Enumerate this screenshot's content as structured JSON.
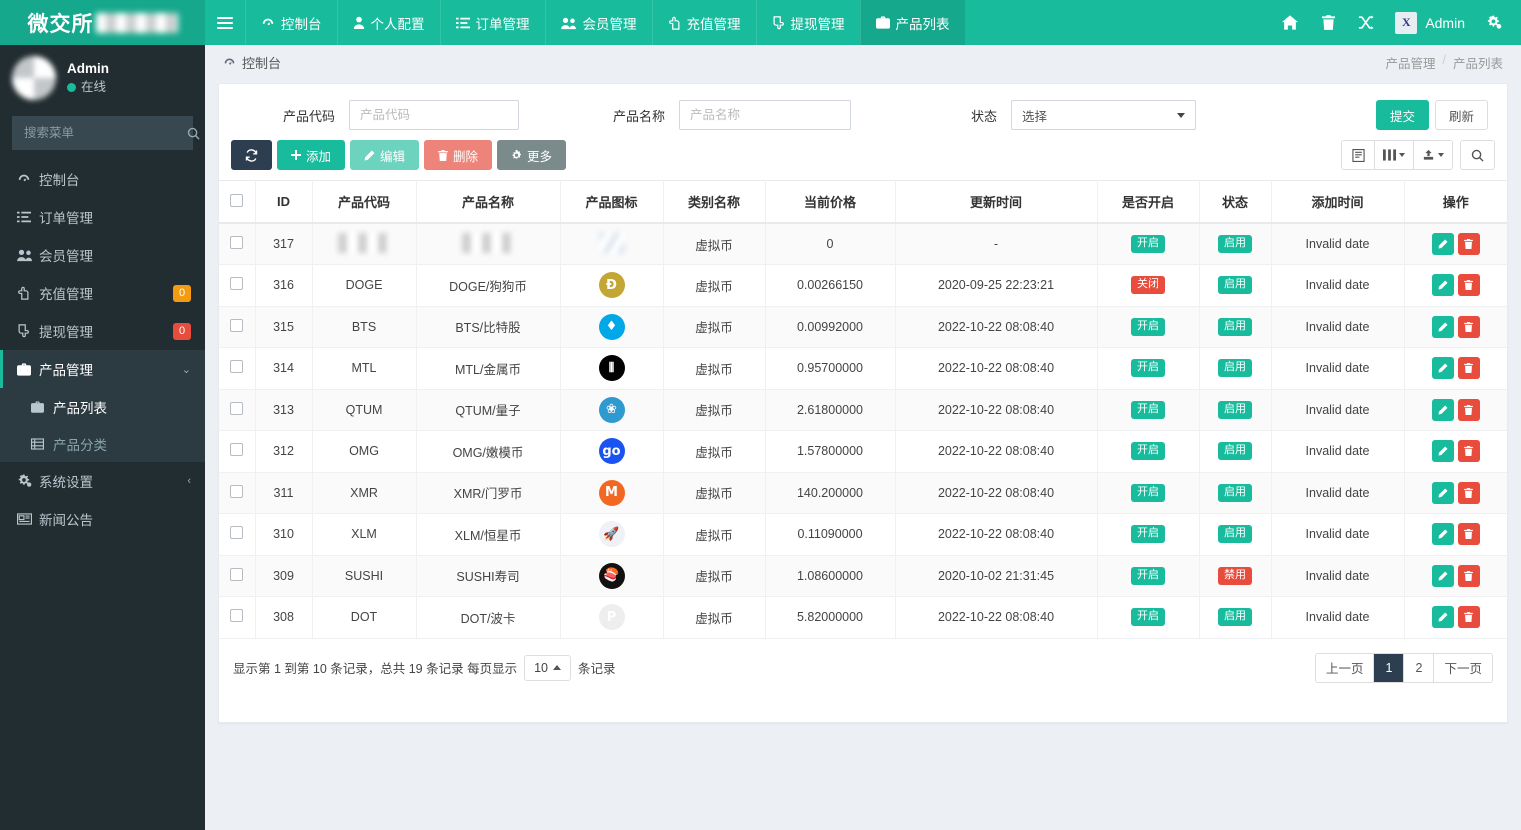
{
  "navbar": {
    "brand": "微交所",
    "brand_redacted": true,
    "toggle_label": "菜单",
    "items": [
      {
        "label": "控制台",
        "icon": "dashboard-icon",
        "active": false
      },
      {
        "label": "个人配置",
        "icon": "user-icon",
        "active": false
      },
      {
        "label": "订单管理",
        "icon": "list-icon",
        "active": false
      },
      {
        "label": "会员管理",
        "icon": "users-icon",
        "active": false
      },
      {
        "label": "充值管理",
        "icon": "hand-up-icon",
        "active": false
      },
      {
        "label": "提现管理",
        "icon": "hand-down-icon",
        "active": false
      },
      {
        "label": "产品列表",
        "icon": "briefcase-icon",
        "active": true
      }
    ],
    "right_icons": [
      "home-icon",
      "trash-icon",
      "shuffle-icon"
    ],
    "user": "Admin",
    "avatar_text": "X",
    "settings_icon": "gears-icon"
  },
  "sidebar": {
    "user_name": "Admin",
    "user_status": "在线",
    "search_placeholder": "搜索菜单",
    "search_value": "",
    "items": [
      {
        "label": "控制台",
        "icon": "dashboard-icon",
        "badge": "",
        "badge_color": "",
        "active": false,
        "caret": ""
      },
      {
        "label": "订单管理",
        "icon": "list-icon",
        "badge": "",
        "badge_color": "",
        "active": false,
        "caret": ""
      },
      {
        "label": "会员管理",
        "icon": "users-icon",
        "badge": "",
        "badge_color": "",
        "active": false,
        "caret": ""
      },
      {
        "label": "充值管理",
        "icon": "hand-up-icon",
        "badge": "0",
        "badge_color": "#f39c12",
        "active": false,
        "caret": ""
      },
      {
        "label": "提现管理",
        "icon": "hand-down-icon",
        "badge": "0",
        "badge_color": "#e74c3c",
        "active": false,
        "caret": ""
      },
      {
        "label": "产品管理",
        "icon": "briefcase-icon",
        "badge": "",
        "badge_color": "",
        "active": true,
        "caret": "⌄"
      }
    ],
    "submenu": [
      {
        "label": "产品列表",
        "icon": "briefcase-icon",
        "active": true
      },
      {
        "label": "产品分类",
        "icon": "th-list-icon",
        "active": false
      }
    ],
    "items_after": [
      {
        "label": "系统设置",
        "icon": "gears-icon",
        "caret": "‹"
      },
      {
        "label": "新闻公告",
        "icon": "newspaper-icon",
        "caret": ""
      }
    ]
  },
  "content_header": {
    "title": "控制台",
    "icon": "dashboard-icon",
    "breadcrumb": [
      "产品管理",
      "产品列表"
    ],
    "breadcrumb_sep": "/"
  },
  "filters": {
    "code_label": "产品代码",
    "code_placeholder": "产品代码",
    "code_value": "",
    "name_label": "产品名称",
    "name_placeholder": "产品名称",
    "name_value": "",
    "status_label": "状态",
    "status_value": "选择",
    "status_options": [
      "选择"
    ],
    "submit_label": "提交",
    "refresh_label": "刷新"
  },
  "toolbar": {
    "refresh_icon": "refresh-icon",
    "add_label": "添加",
    "edit_label": "编辑",
    "delete_label": "删除",
    "more_label": "更多",
    "right_buttons": [
      {
        "icon": "detail-view-icon",
        "caret": false
      },
      {
        "icon": "columns-icon",
        "caret": true
      },
      {
        "icon": "export-icon",
        "caret": true
      },
      {
        "icon": "search-icon",
        "caret": false
      }
    ]
  },
  "table": {
    "columns": [
      "",
      "ID",
      "产品代码",
      "产品名称",
      "产品图标",
      "类别名称",
      "当前价格",
      "更新时间",
      "是否开启",
      "状态",
      "添加时间",
      "操作"
    ],
    "rows": [
      {
        "id": "317",
        "code": "",
        "name": "",
        "icon_redacted": true,
        "icon_bg": "#ffffff",
        "icon_text": "",
        "category": "虚拟币",
        "price": "0",
        "updated": "-",
        "enabled": "开启",
        "enabled_color": "green",
        "status": "启用",
        "status_color": "green",
        "added": "Invalid date",
        "redacted": true
      },
      {
        "id": "316",
        "code": "DOGE",
        "name": "DOGE/狗狗币",
        "icon_bg": "#c3a634",
        "icon_text": "Ð",
        "category": "虚拟币",
        "price": "0.00266150",
        "updated": "2020-09-25 22:23:21",
        "enabled": "关闭",
        "enabled_color": "red",
        "status": "启用",
        "status_color": "green",
        "added": "Invalid date",
        "redacted": false
      },
      {
        "id": "315",
        "code": "BTS",
        "name": "BTS/比特股",
        "icon_bg": "#00a8e8",
        "icon_text": "♦",
        "category": "虚拟币",
        "price": "0.00992000",
        "updated": "2022-10-22 08:08:40",
        "enabled": "开启",
        "enabled_color": "green",
        "status": "启用",
        "status_color": "green",
        "added": "Invalid date",
        "redacted": false
      },
      {
        "id": "314",
        "code": "MTL",
        "name": "MTL/金属币",
        "icon_bg": "#000000",
        "icon_text": "⦀",
        "category": "虚拟币",
        "price": "0.95700000",
        "updated": "2022-10-22 08:08:40",
        "enabled": "开启",
        "enabled_color": "green",
        "status": "启用",
        "status_color": "green",
        "added": "Invalid date",
        "redacted": false
      },
      {
        "id": "313",
        "code": "QTUM",
        "name": "QTUM/量子",
        "icon_bg": "#2e9ad0",
        "icon_text": "❀",
        "category": "虚拟币",
        "price": "2.61800000",
        "updated": "2022-10-22 08:08:40",
        "enabled": "开启",
        "enabled_color": "green",
        "status": "启用",
        "status_color": "green",
        "added": "Invalid date",
        "redacted": false
      },
      {
        "id": "312",
        "code": "OMG",
        "name": "OMG/嫩模币",
        "icon_bg": "#1a53f0",
        "icon_text": "go",
        "category": "虚拟币",
        "price": "1.57800000",
        "updated": "2022-10-22 08:08:40",
        "enabled": "开启",
        "enabled_color": "green",
        "status": "启用",
        "status_color": "green",
        "added": "Invalid date",
        "redacted": false
      },
      {
        "id": "311",
        "code": "XMR",
        "name": "XMR/门罗币",
        "icon_bg": "#f26822",
        "icon_text": "M",
        "category": "虚拟币",
        "price": "140.200000",
        "updated": "2022-10-22 08:08:40",
        "enabled": "开启",
        "enabled_color": "green",
        "status": "启用",
        "status_color": "green",
        "added": "Invalid date",
        "redacted": false
      },
      {
        "id": "310",
        "code": "XLM",
        "name": "XLM/恒星币",
        "icon_bg": "#eef1f5",
        "icon_text": "🚀",
        "category": "虚拟币",
        "price": "0.11090000",
        "updated": "2022-10-22 08:08:40",
        "enabled": "开启",
        "enabled_color": "green",
        "status": "启用",
        "status_color": "green",
        "added": "Invalid date",
        "redacted": false
      },
      {
        "id": "309",
        "code": "SUSHI",
        "name": "SUSHI寿司",
        "icon_bg": "#111111",
        "icon_text": "🍣",
        "category": "虚拟币",
        "price": "1.08600000",
        "updated": "2020-10-02 21:31:45",
        "enabled": "开启",
        "enabled_color": "green",
        "status": "禁用",
        "status_color": "red",
        "added": "Invalid date",
        "redacted": false
      },
      {
        "id": "308",
        "code": "DOT",
        "name": "DOT/波卡",
        "icon_bg": "#eeeeee",
        "icon_text": "P",
        "category": "虚拟币",
        "price": "5.82000000",
        "updated": "2022-10-22 08:08:40",
        "enabled": "开启",
        "enabled_color": "green",
        "status": "启用",
        "status_color": "green",
        "added": "Invalid date",
        "redacted": false
      }
    ],
    "row_actions": {
      "edit_icon": "pencil-icon",
      "delete_icon": "trash-icon"
    }
  },
  "footer": {
    "summary_prefix": "显示第 1 到第 10 条记录，总共 19 条记录 每页显示",
    "page_size": "10",
    "summary_suffix": "条记录",
    "pager": [
      {
        "label": "上一页",
        "active": false
      },
      {
        "label": "1",
        "active": true
      },
      {
        "label": "2",
        "active": false
      },
      {
        "label": "下一页",
        "active": false
      }
    ]
  },
  "colors": {
    "brand_green": "#18bc9c",
    "sidebar_dark": "#222d32",
    "sidebar_active": "#2c3b41",
    "danger": "#e74c3c",
    "warning": "#f39c12",
    "page_bg": "#ecf0f5"
  }
}
